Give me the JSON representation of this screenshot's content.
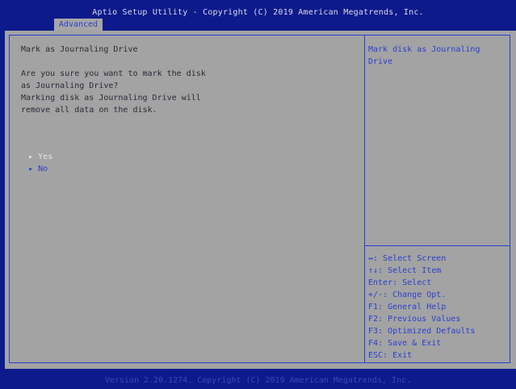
{
  "header": {
    "title": "Aptio Setup Utility - Copyright (C) 2019 American Megatrends, Inc.",
    "tab": "Advanced"
  },
  "main": {
    "heading": "Mark as Journaling Drive",
    "question_lines": [
      "Are you sure you want to mark the disk",
      "as Journaling Drive?",
      "Marking disk as Journaling Drive will",
      "remove all data on the disk."
    ],
    "options": [
      {
        "label": "Yes",
        "selected": true
      },
      {
        "label": "No",
        "selected": false
      }
    ]
  },
  "help": {
    "text": "Mark disk as Journaling Drive"
  },
  "keys": [
    "↔: Select Screen",
    "↑↓: Select Item",
    "Enter: Select",
    "+/-: Change Opt.",
    "F1: General Help",
    "F2: Previous Values",
    "F3: Optimized Defaults",
    "F4: Save & Exit",
    "ESC: Exit"
  ],
  "footer": {
    "text": "Version 2.20.1274. Copyright (C) 2019 American Megatrends, Inc."
  },
  "colors": {
    "background": "#0d1a8c",
    "panel": "#a3a3a3",
    "accent": "#2a3fd0",
    "selected_text": "#e6e6e6"
  }
}
